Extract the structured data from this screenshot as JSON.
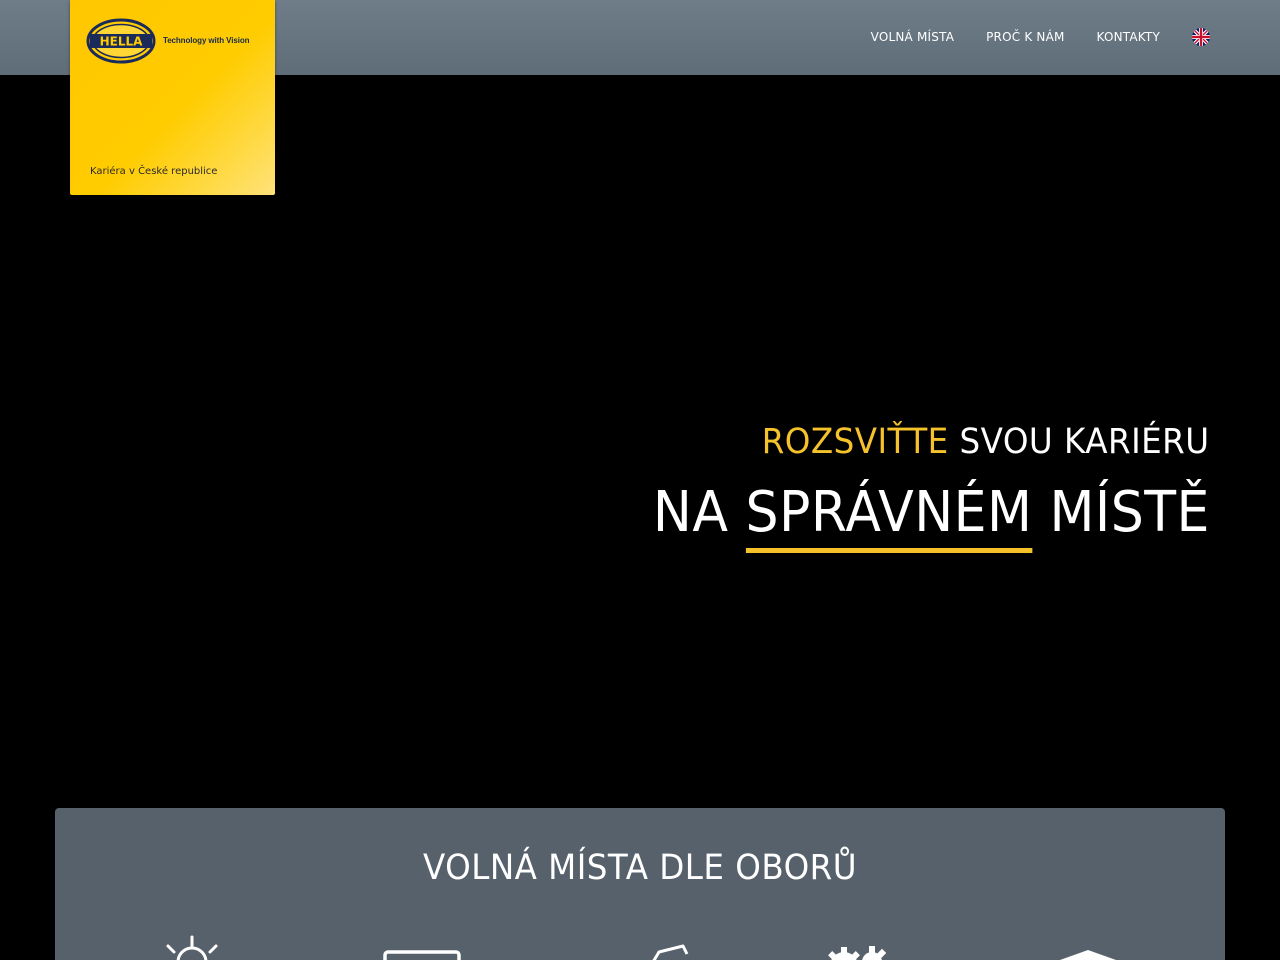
{
  "header": {
    "nav": [
      {
        "label": "VOLNÁ MÍSTA"
      },
      {
        "label": "PROČ K NÁM"
      },
      {
        "label": "KONTAKTY"
      }
    ],
    "language_icon": "uk-flag-icon"
  },
  "logo": {
    "brand": "HELLA",
    "tagline": "Technology with Vision",
    "subtitle": "Kariéra v České republice",
    "color": "#ffcc00"
  },
  "hero": {
    "line1_accent": "ROZSVIŤTE",
    "line1_rest": "SVOU KARIÉRU",
    "line2_start": "NA",
    "line2_underlined": "SPRÁVNÉM",
    "line2_end": "MÍSTĚ",
    "accent_color": "#f5c22c"
  },
  "categories": {
    "title": "VOLNÁ MÍSTA DLE OBORŮ",
    "icons": [
      "light-bulb-icon",
      "monitor-icon",
      "document-icon",
      "gears-icon",
      "graduation-cap-icon"
    ]
  }
}
